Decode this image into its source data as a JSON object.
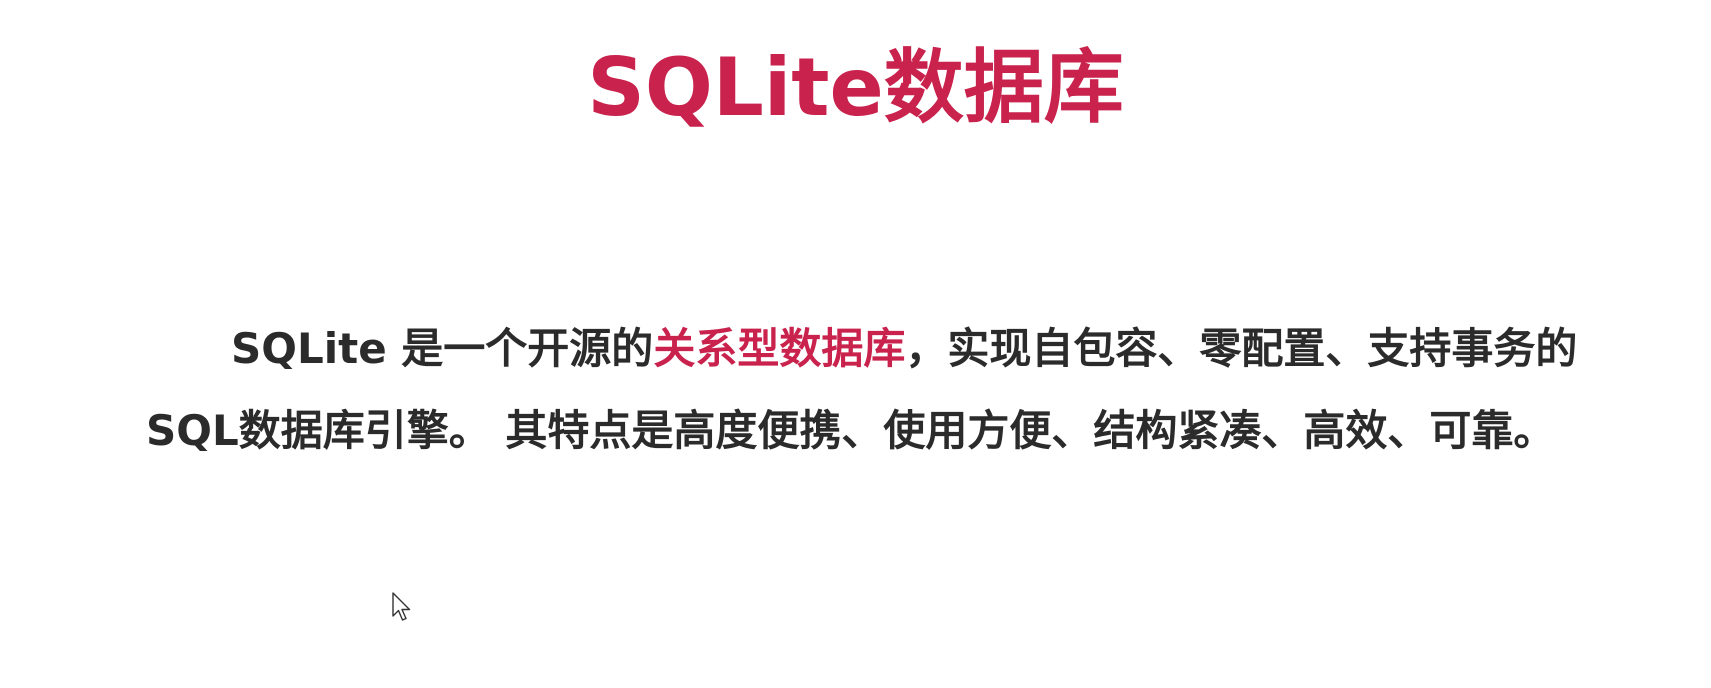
{
  "slide": {
    "title": "SQLite数据库",
    "paragraph": {
      "before": "SQLite 是一个开源的",
      "highlight": "关系型数据库",
      "after": "，实现自包容、零配置、支持事务的SQL数据库引擎。 其特点是高度便携、使用方便、结构紧凑、高效、可靠。"
    },
    "colors": {
      "accent": "#c8224d",
      "text": "#2b2b2b",
      "background": "#ffffff"
    },
    "icons": {
      "cursor": "mouse-pointer-icon"
    }
  }
}
